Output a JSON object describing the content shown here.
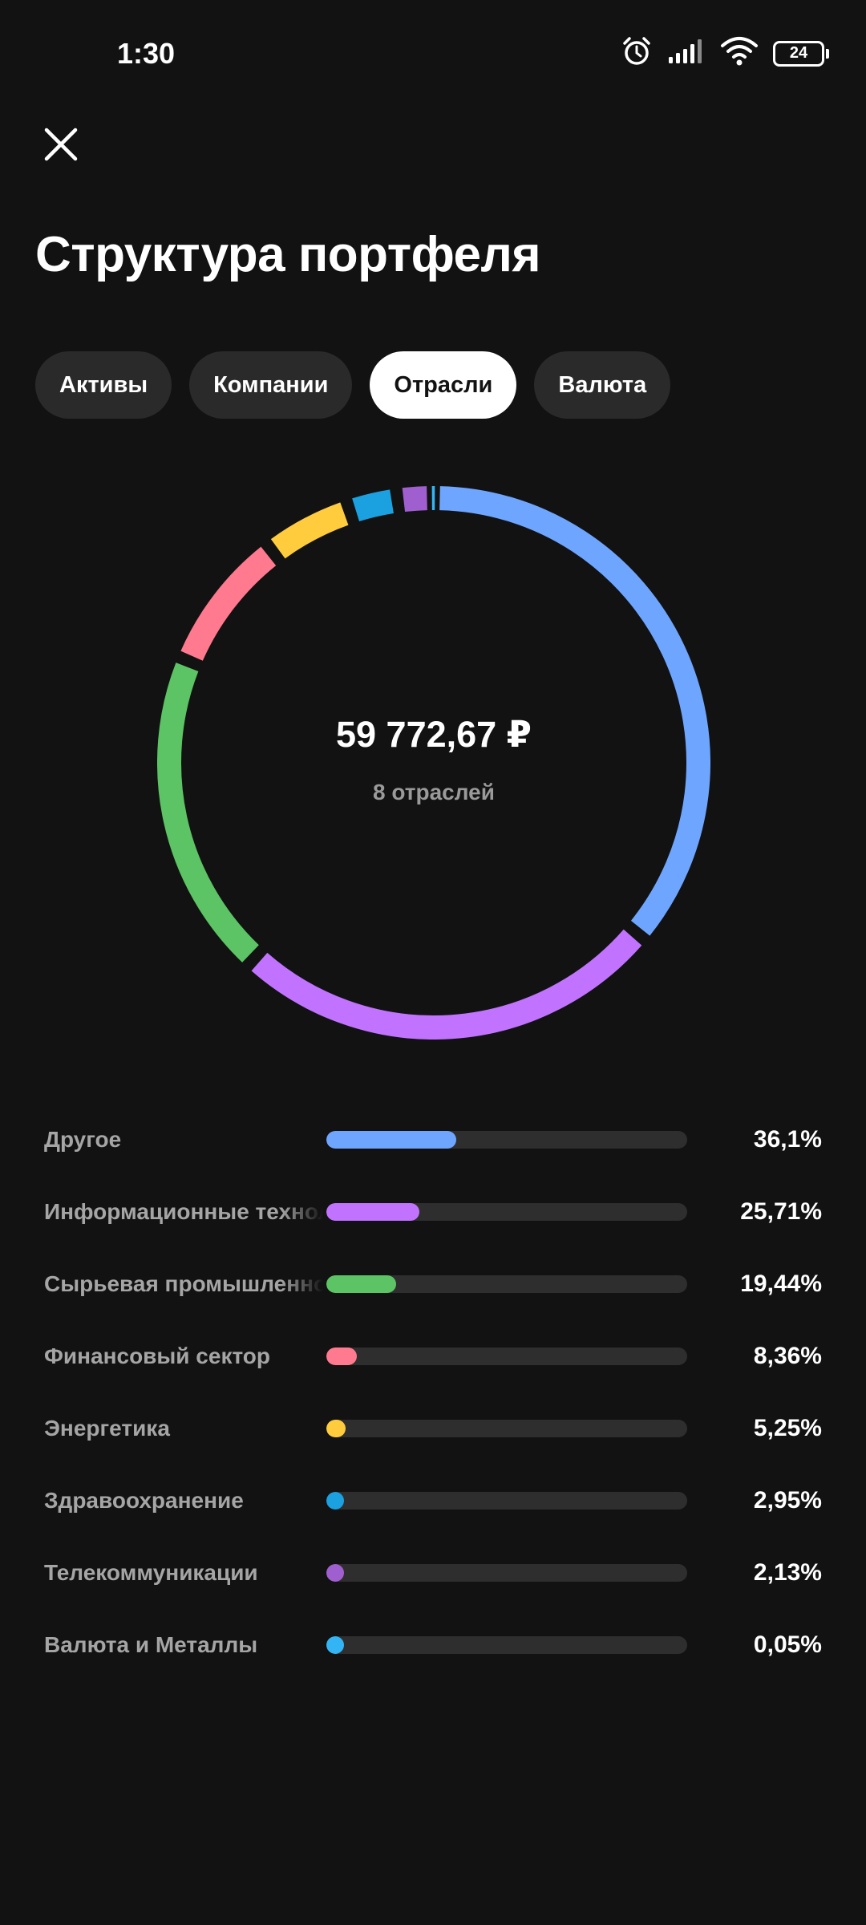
{
  "status": {
    "time": "1:30",
    "battery": "24"
  },
  "header": {
    "title": "Структура портфеля"
  },
  "tabs": [
    {
      "label": "Активы",
      "active": false
    },
    {
      "label": "Компании",
      "active": false
    },
    {
      "label": "Отрасли",
      "active": true
    },
    {
      "label": "Валюта",
      "active": false
    }
  ],
  "summary": {
    "total": "59 772,67 ₽",
    "count_label": "8 отраслей"
  },
  "sectors": [
    {
      "label": "Другое",
      "value_text": "36,1%",
      "percent": 36.1,
      "color": "#6ea6ff"
    },
    {
      "label": "Информационные технологии",
      "value_text": "25,71%",
      "percent": 25.71,
      "color": "#c173ff"
    },
    {
      "label": "Сырьевая промышленность",
      "value_text": "19,44%",
      "percent": 19.44,
      "color": "#5cc465"
    },
    {
      "label": "Финансовый сектор",
      "value_text": "8,36%",
      "percent": 8.36,
      "color": "#ff7a8e"
    },
    {
      "label": "Энергетика",
      "value_text": "5,25%",
      "percent": 5.25,
      "color": "#ffcc3d"
    },
    {
      "label": "Здравоохранение",
      "value_text": "2,95%",
      "percent": 2.95,
      "color": "#1ba0e0"
    },
    {
      "label": "Телекоммуникации",
      "value_text": "2,13%",
      "percent": 2.13,
      "color": "#a05fcf"
    },
    {
      "label": "Валюта и Металлы",
      "value_text": "0,05%",
      "percent": 0.05,
      "color": "#33b5f5"
    }
  ]
}
